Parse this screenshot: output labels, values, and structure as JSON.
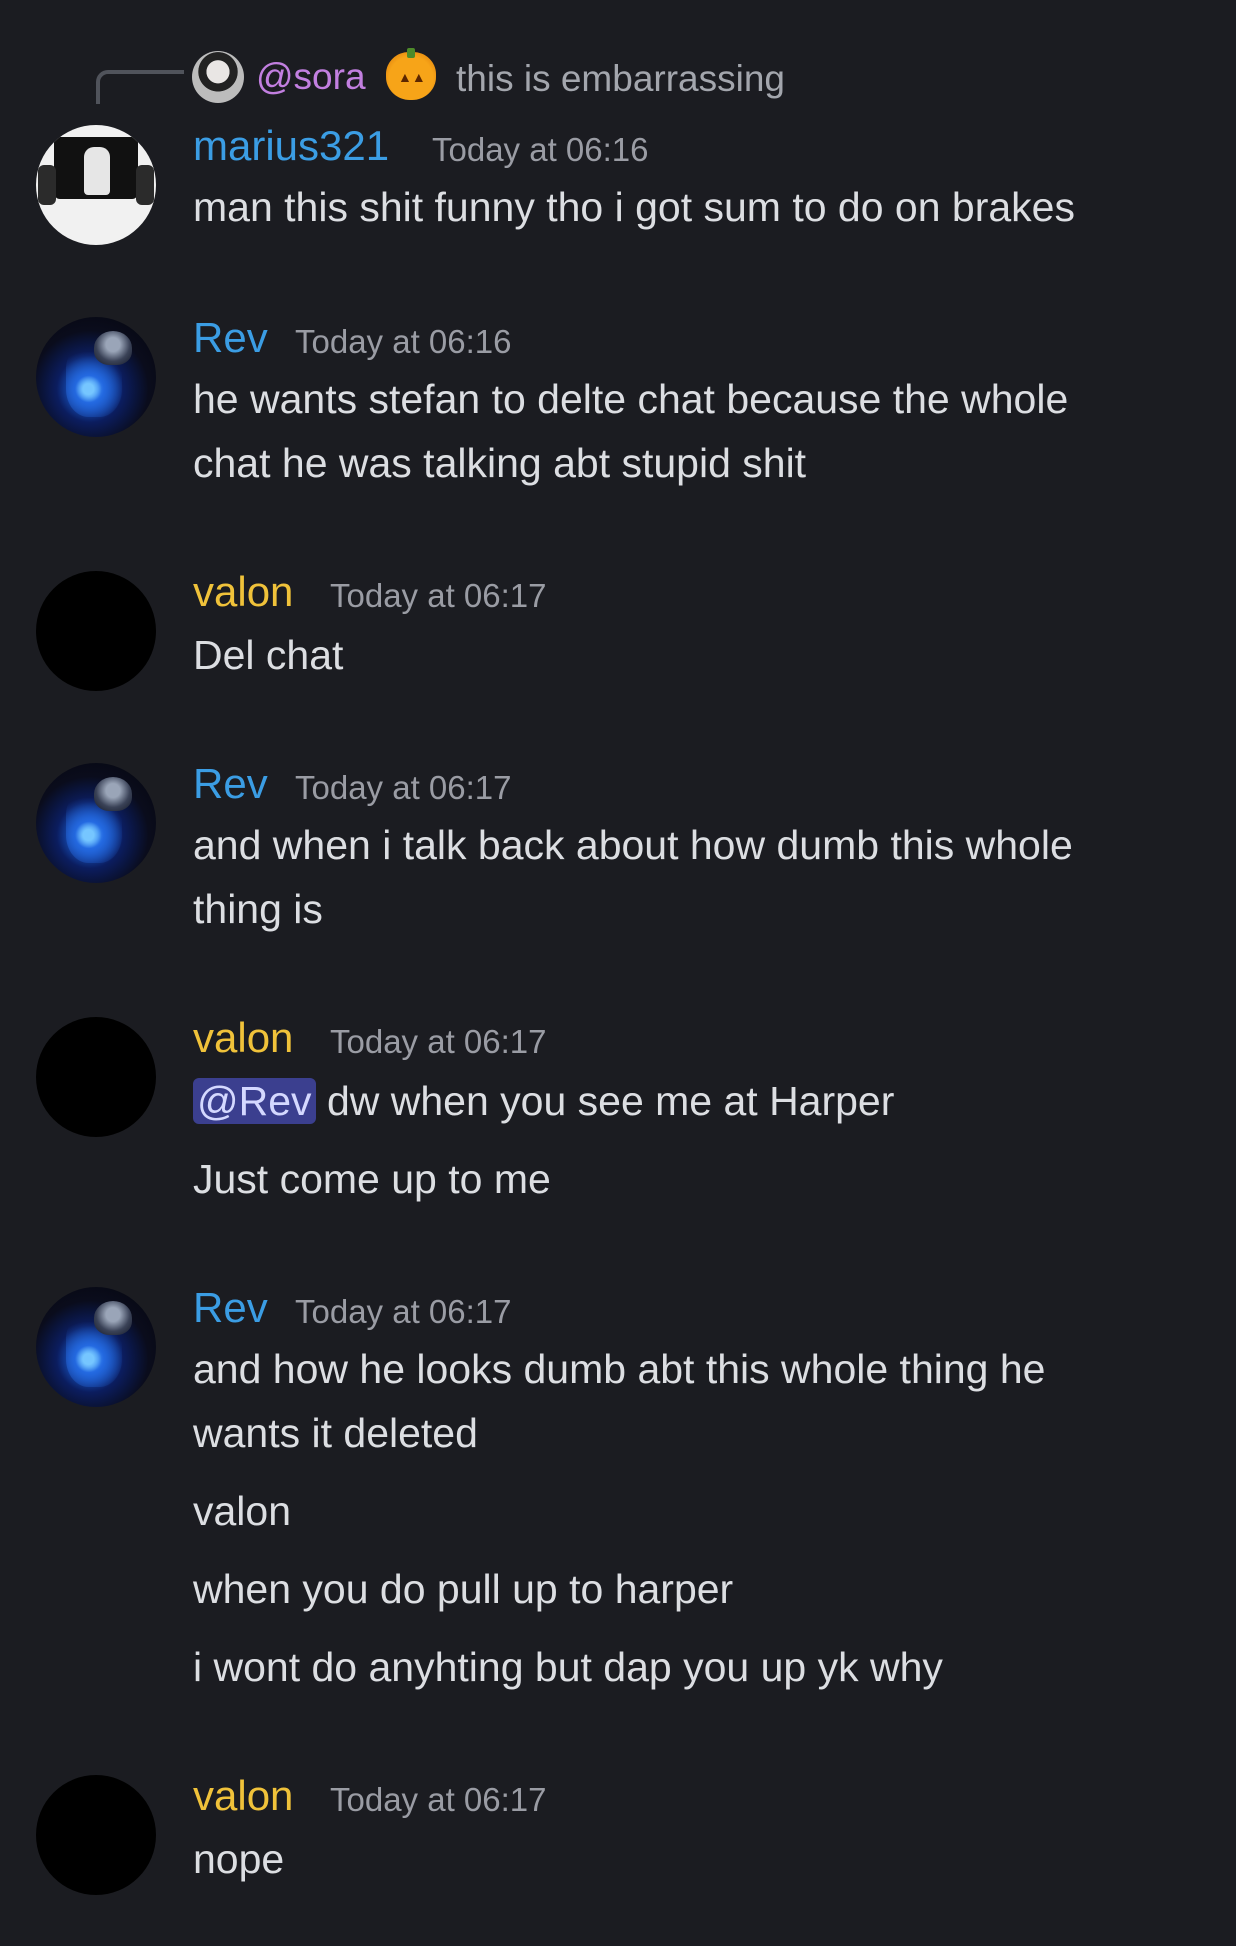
{
  "reply": {
    "username": "@sora",
    "emoji": "pumpkin",
    "text": "this is embarrassing"
  },
  "messages": [
    {
      "author": "marius321",
      "color": "#3b9de4",
      "time": "Today at 06:16",
      "lines": [
        "man this shit funny tho i got sum to do on brakes"
      ]
    },
    {
      "author": "Rev",
      "color": "#3b9de4",
      "time": "Today at 06:16",
      "lines": [
        "he wants stefan to delte chat because the whole",
        "chat he was talking abt stupid shit"
      ]
    },
    {
      "author": "valon",
      "color": "#f0c23a",
      "time": "Today at 06:17",
      "lines": [
        "Del chat"
      ]
    },
    {
      "author": "Rev",
      "color": "#3b9de4",
      "time": "Today at 06:17",
      "lines": [
        "and when i talk back about how dumb this whole",
        "thing is"
      ]
    },
    {
      "author": "valon",
      "color": "#f0c23a",
      "time": "Today at 06:17",
      "mention": "@Rev",
      "lines": [
        " dw when you see me at Harper",
        "Just come up to me"
      ]
    },
    {
      "author": "Rev",
      "color": "#3b9de4",
      "time": "Today at 06:17",
      "lines": [
        "and how he looks dumb abt this whole thing he",
        "wants it deleted",
        "valon",
        "when you do pull up to harper",
        "i wont do anyhting but dap you up yk why"
      ]
    },
    {
      "author": "valon",
      "color": "#f0c23a",
      "time": "Today at 06:17",
      "lines": [
        "nope"
      ]
    }
  ]
}
